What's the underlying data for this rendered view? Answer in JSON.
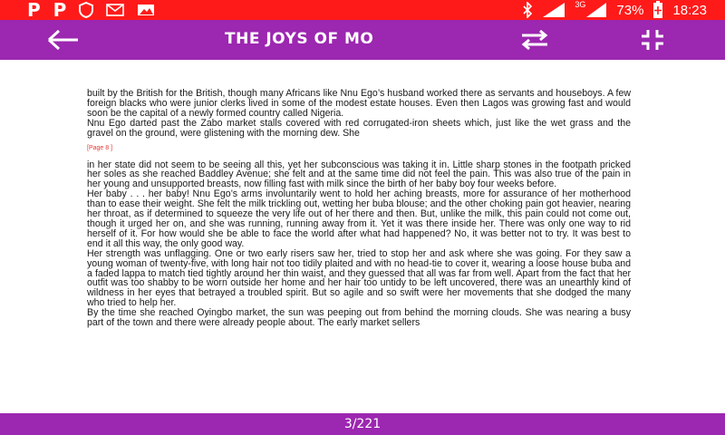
{
  "status_bar": {
    "notification_icons": [
      "pinterest-icon",
      "pinterest-icon",
      "shield-icon",
      "mail-icon",
      "image-icon"
    ],
    "network": "3G",
    "battery": "73%",
    "time": "18:23"
  },
  "app_bar": {
    "title": "THE JOYS OF MO",
    "back_icon": "arrow-left-icon",
    "swap_icon": "swap-horizontal-icon",
    "fullscreen_icon": "fullscreen-exit-icon"
  },
  "content": {
    "paragraphs": [
      "built by the British for the British, though many Africans like Nnu Ego’s husband worked there as servants and houseboys. A few foreign blacks who were junior clerks lived in some of the modest estate houses. Even then Lagos was growing fast and would soon be the capital of a newly formed country called Nigeria.",
      "Nnu Ego darted past the Zabo market stalls covered with red corrugated-iron sheets which, just like the wet grass and the gravel on the ground, were glistening with the morning dew. She"
    ],
    "page_marker": "[Page 8 ]",
    "paragraphs_after": [
      "in her state did not seem to be seeing all this, yet her subconscious was taking it in. Little sharp stones in the footpath pricked her soles as she reached Baddley Avenue; she felt and at the same time did not feel the pain. This was also true of the pain in her young and unsupported breasts, now filling fast with milk since the birth of her baby boy four weeks before.",
      "Her baby . . . her baby! Nnu Ego’s arms involuntarily went to hold her aching breasts, more for assurance of her motherhood than to ease their weight. She felt the milk trickling out, wetting her buba blouse; and the other choking pain got heavier, nearing her throat, as if determined to squeeze the very life out of her there and then. But, unlike the milk, this pain could not come out, though it urged her on, and she was running, running away from it. Yet it was there inside her. There was only one way to rid herself of it. For how would she be able to face the world after what had happened? No, it was better not to try. It was best to end it all this way, the only good way.",
      "Her strength was unflagging. One or two early risers saw her, tried to stop her and ask where she was going. For they saw a young woman of twenty-five, with long hair not too tidily plaited and with no head-tie to cover it, wearing a loose house buba and a faded lappa to match tied tightly around her thin waist, and they guessed that all was far from well. Apart from the fact that her outfit was too shabby to be worn outside her home and her hair too untidy to be left uncovered, there was an unearthly kind of wildness in her eyes that betrayed a troubled spirit. But so agile and so swift were her movements that she dodged the many who tried to help her.",
      "By the time she reached Oyingbo market, the sun was peeping out from behind the morning clouds. She was nearing a busy part of the town and there were already people about. The early market sellers"
    ]
  },
  "bottom_bar": {
    "page_indicator": "3/221"
  }
}
